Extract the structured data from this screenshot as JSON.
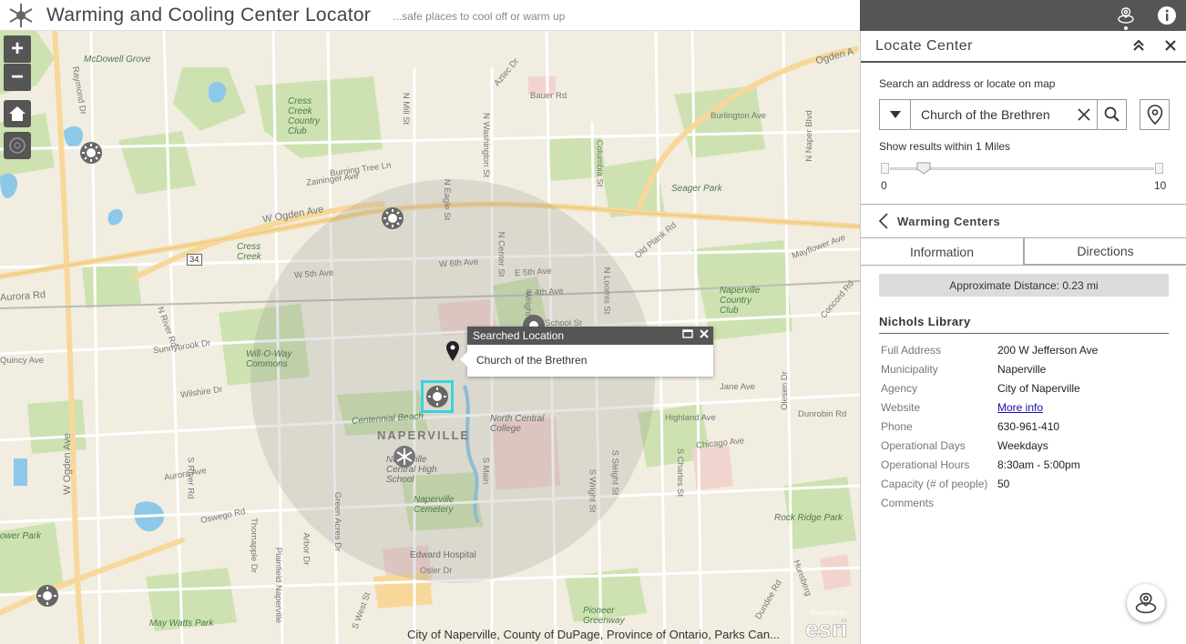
{
  "header": {
    "title": "Warming and Cooling Center Locator",
    "subtitle": "...safe places to cool off or warm up",
    "icons": [
      "snowflake-sun-logo",
      "locate-widget-icon",
      "info-icon"
    ]
  },
  "map": {
    "controls": {
      "zoom_in": "+",
      "zoom_out": "−"
    },
    "labels": {
      "mcdowell_grove": "McDowell Grove",
      "cress_creek_cc": "Cress\nCreek\nCountry\nClub",
      "burning_tree": "Burning Tree Ln",
      "zaininger": "Zaininger Ave",
      "w_ogden": "W Ogden Ave",
      "ogden_ne": "Ogden A",
      "cress_creek": "Cress\nCreek",
      "aurora_rd": "Aurora Rd",
      "quincy": "Quincy Ave",
      "sunnybrook": "Sunnybrook Dr",
      "wilsire": "Wilshire Dr",
      "will_o_way": "Will-O-Way\nCommons",
      "centennial": "Centennial Beach",
      "naperville": "NAPERVILLE",
      "ncc": "North Central\nCollege",
      "naperville_central": "Naperville\nCentral High\nSchool",
      "naperville_cemetery": "Naperville\nCemetery",
      "edward_hospital": "Edward Hospital",
      "osler": "Osler Dr",
      "seager_park": "Seager Park",
      "burlington": "Burlington Ave",
      "bauer": "Bauer Rd",
      "old_plank": "Old Plank Rd",
      "mayflower": "Mayflower Ave",
      "naperville_cc": "Naperville\nCountry\nClub",
      "concord": "Concord Rd",
      "jane": "Jane Ave",
      "dunrobin": "Dunrobin Rd",
      "rock_ridge": "Rock Ridge Park",
      "pioneer": "Pioneer\nGreenway",
      "may_watts": "May Watts Park",
      "power_park": "ower Park",
      "w_5th": "W 5th Ave",
      "w_6th": "W 6th Ave",
      "e_5th": "E 5th Ave",
      "e_4th": "E 4th Ave",
      "school_st": "School St",
      "highland": "Highland Ave",
      "chicago": "Chicago Ave",
      "aurora_ave": "Aurora Ave",
      "oswego": "Oswego Rd",
      "w_ogden_vert": "W Ogden Ave",
      "n_river": "N River Rd",
      "s_river": "S River Rd",
      "raymond": "Raymond Dr",
      "n_mill": "N Mill St",
      "n_eagle": "N Eagle St",
      "n_center": "N Center St",
      "n_washington": "N Washington St",
      "columbia": "Columbia St",
      "n_loomis": "N Loomis St",
      "s_charles": "S Charles St",
      "olesen": "Olesen Dr",
      "naper": "N Naper Blvd",
      "route_34": "34",
      "thornapple": "Thornapple Dr",
      "arbor": "Arbor Dr",
      "green_acres": "Green Acres Dr",
      "plainfield": "Plainfield Naperville",
      "s_west": "S West St",
      "s_main": "S Main",
      "s_wright": "S Wright St",
      "s_sleight": "S Sleight St",
      "dundee": "Dundee Rd",
      "hunsberg": "Hunsberg",
      "aztec": "Aztec Dr",
      "wright": "Wright St"
    },
    "popup": {
      "title": "Searched Location",
      "body": "Church of the Brethren"
    },
    "attribution": "City of Naperville, County of DuPage, Province of Ontario, Parks Can...",
    "esri_badge": "POWERED BY esri"
  },
  "panel": {
    "title": "Locate Center",
    "search_label": "Search an address or locate on map",
    "search_value": "Church of the Brethren",
    "range_label": "Show results within 1 Miles",
    "range_min": "0",
    "range_max": "10",
    "slider_value": 1,
    "back_label": "Warming Centers",
    "tabs": [
      "Information",
      "Directions"
    ],
    "distance": "Approximate Distance: 0.23 mi",
    "location_name": "Nichols Library",
    "fields": [
      {
        "key": "Full Address",
        "value": "200 W Jefferson Ave"
      },
      {
        "key": "Municipality",
        "value": "Naperville"
      },
      {
        "key": "Agency",
        "value": "City of Naperville"
      },
      {
        "key": "Website",
        "value": "More info"
      },
      {
        "key": "Phone",
        "value": "630-961-410"
      },
      {
        "key": "Operational Days",
        "value": "Weekdays"
      },
      {
        "key": "Operational Hours",
        "value": "8:30am - 5:00pm"
      },
      {
        "key": "Capacity (# of people)",
        "value": "50"
      },
      {
        "key": "Comments",
        "value": ""
      }
    ]
  },
  "colors": {
    "dark_gray": "#555555",
    "park_green": "#cde2b0",
    "highlight_cyan": "#35d4e0",
    "road_yellow": "#f7d89a",
    "water_blue": "#8ec8e8"
  }
}
